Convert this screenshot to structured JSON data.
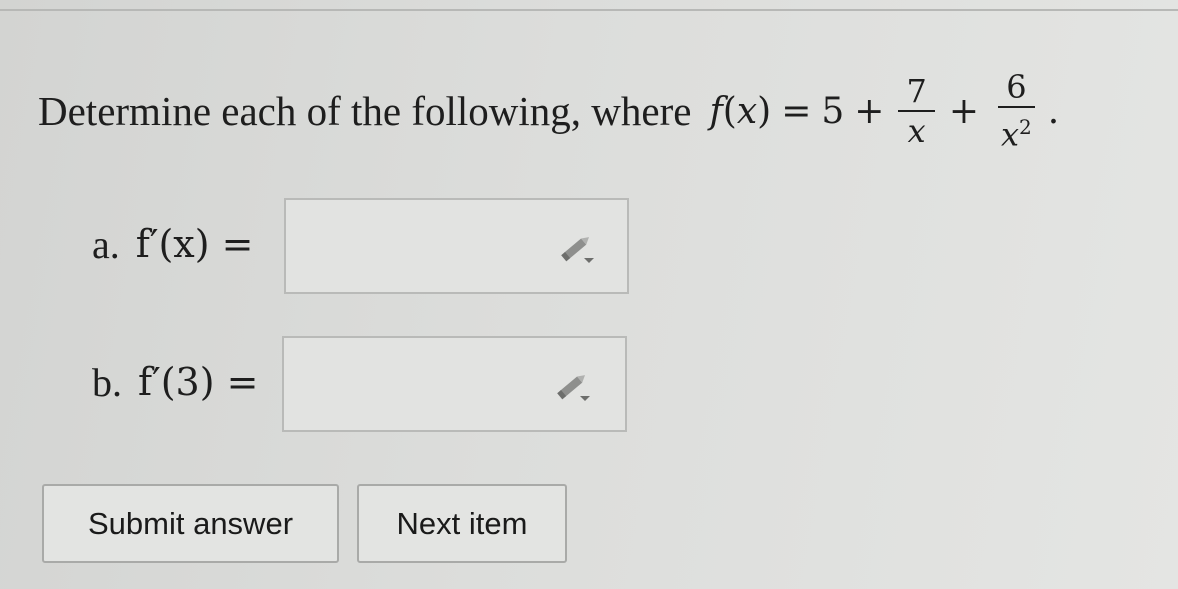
{
  "question": {
    "prompt": "Determine each of the following, where",
    "function": {
      "name": "f",
      "variable": "x",
      "constant": "5",
      "term1": {
        "numerator": "7",
        "denominator": "x"
      },
      "term2": {
        "numerator": "6",
        "denominator": "x",
        "exponent": "2"
      },
      "terminator": "."
    }
  },
  "parts": [
    {
      "letter": "a.",
      "expression": "f′(x) =",
      "answer_value": "",
      "icon": "pencil-icon"
    },
    {
      "letter": "b.",
      "expression": "f′(3) =",
      "answer_value": "",
      "icon": "pencil-icon"
    }
  ],
  "buttons": {
    "submit_label": "Submit answer",
    "next_label": "Next item"
  }
}
